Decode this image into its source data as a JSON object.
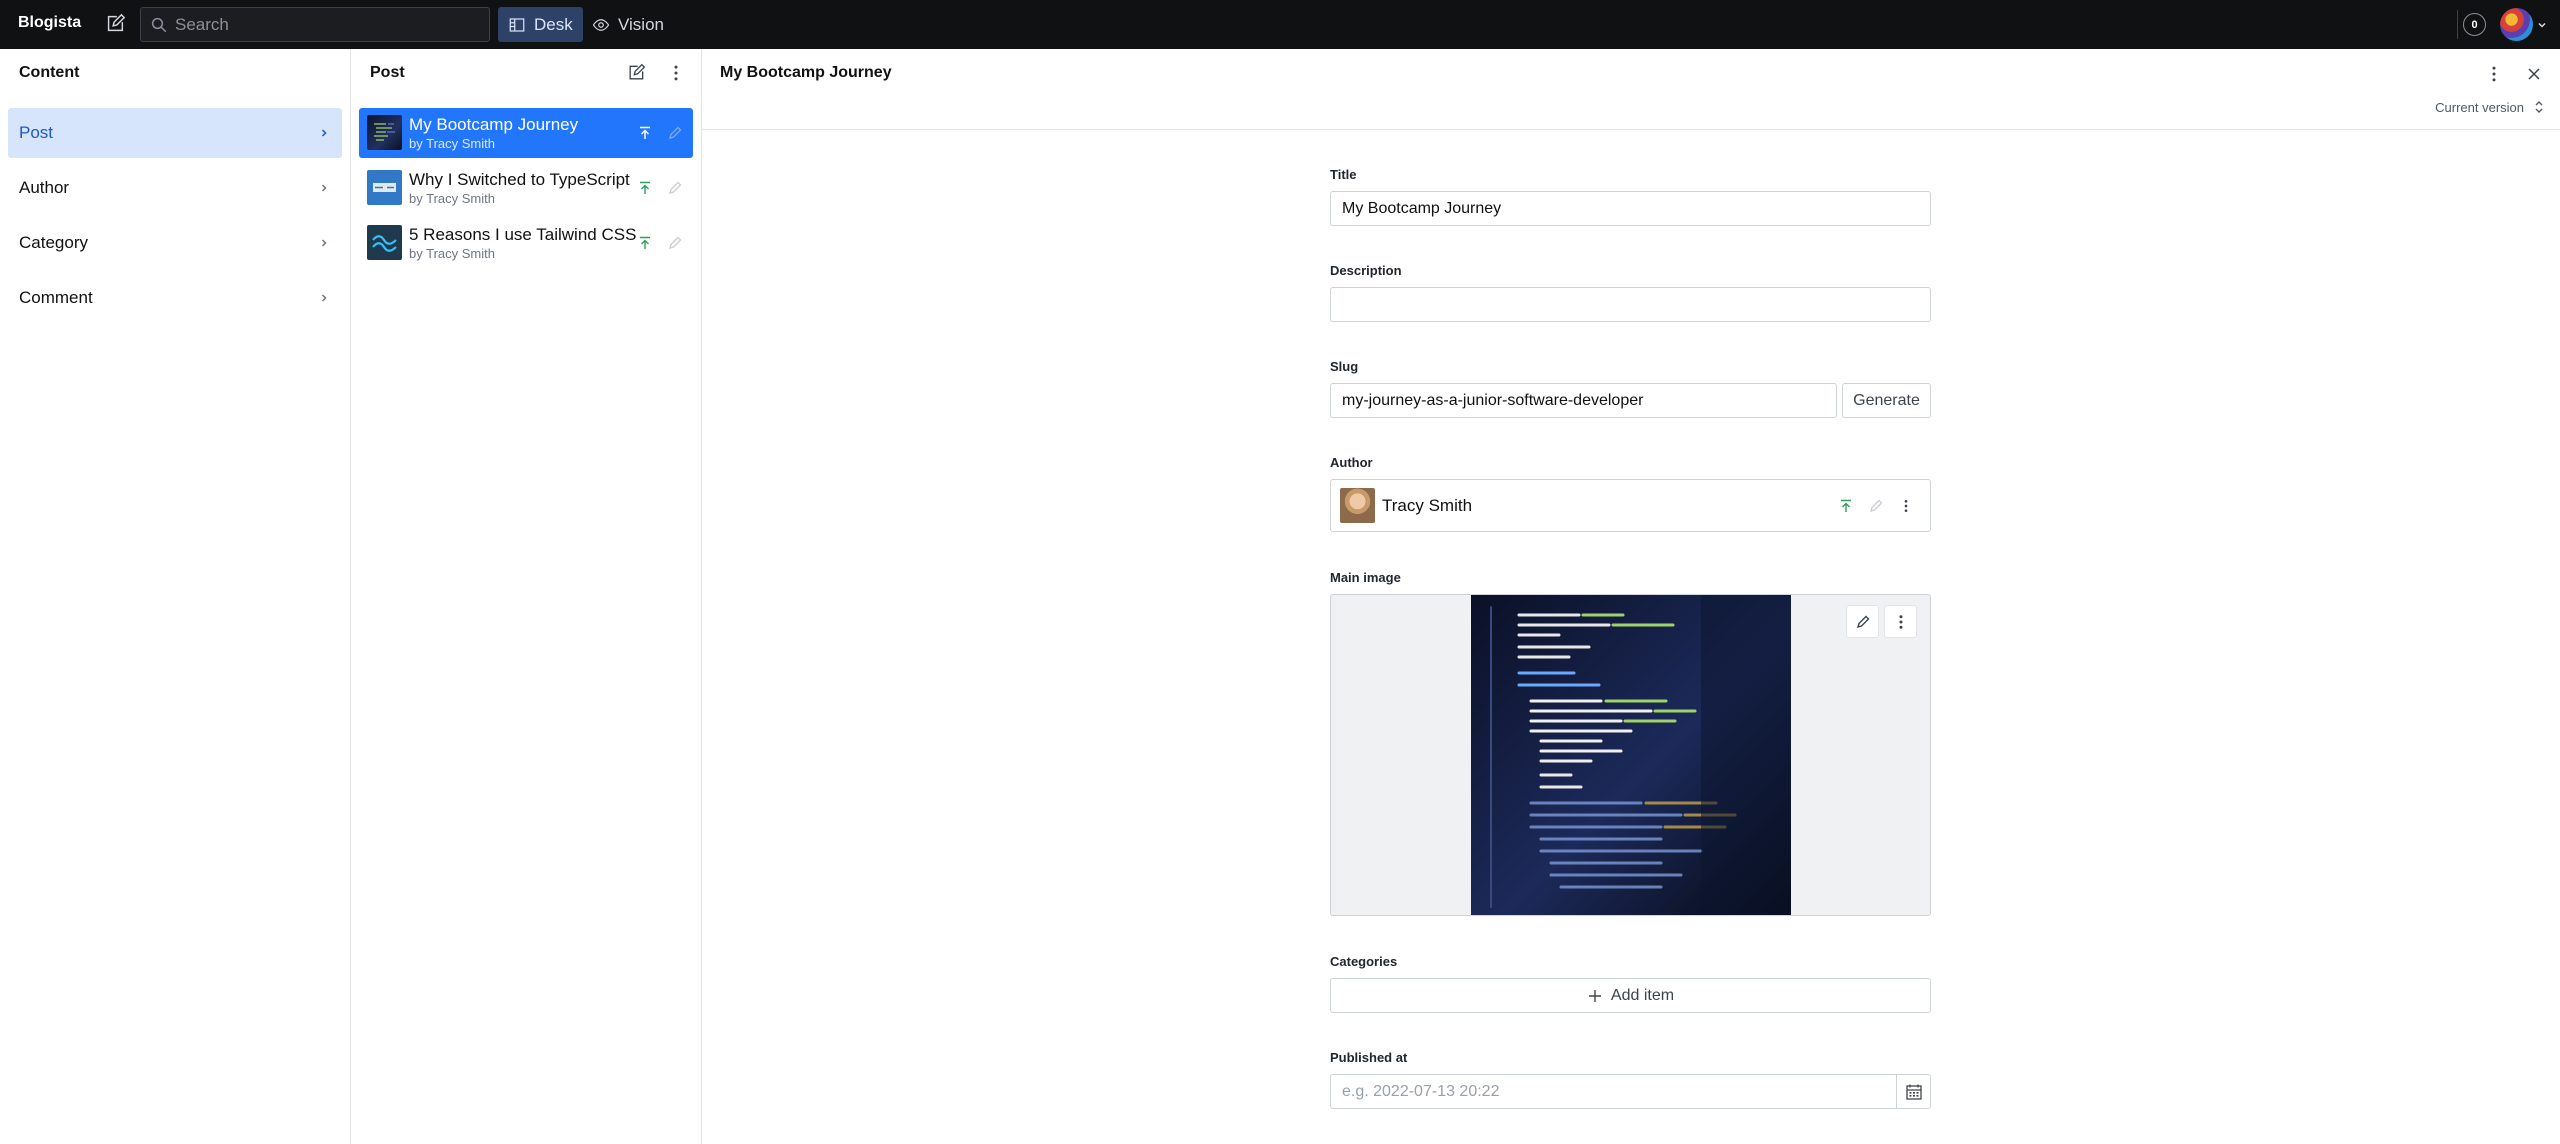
{
  "app": {
    "name": "Blogista"
  },
  "navbar": {
    "search_placeholder": "Search",
    "tools": [
      {
        "label": "Desk",
        "active": true
      },
      {
        "label": "Vision",
        "active": false
      }
    ],
    "notification_count": "0"
  },
  "content_pane": {
    "title": "Content",
    "items": [
      {
        "label": "Post",
        "selected": true
      },
      {
        "label": "Author"
      },
      {
        "label": "Category"
      },
      {
        "label": "Comment"
      }
    ]
  },
  "post_pane": {
    "title": "Post",
    "documents": [
      {
        "title": "My Bootcamp Journey",
        "subtitle": "by Tracy Smith",
        "selected": true,
        "thumb": "code-screen"
      },
      {
        "title": "Why I Switched to TypeScript",
        "subtitle": "by Tracy Smith",
        "thumb": "typescript"
      },
      {
        "title": "5 Reasons I use Tailwind CSS",
        "subtitle": "by Tracy Smith",
        "thumb": "tailwind"
      }
    ]
  },
  "editor": {
    "title": "My Bootcamp Journey",
    "version_label": "Current version",
    "fields": {
      "title": {
        "label": "Title",
        "value": "My Bootcamp Journey"
      },
      "description": {
        "label": "Description",
        "value": ""
      },
      "slug": {
        "label": "Slug",
        "value": "my-journey-as-a-junior-software-developer",
        "button": "Generate"
      },
      "author": {
        "label": "Author",
        "value": "Tracy Smith"
      },
      "main_image": {
        "label": "Main image"
      },
      "categories": {
        "label": "Categories",
        "button": "Add item"
      },
      "published_at": {
        "label": "Published at",
        "placeholder": "e.g. 2022-07-13 20:22"
      }
    }
  },
  "colors": {
    "accent": "#2276fc",
    "published": "#2f9e5e",
    "navbar": "#101112"
  }
}
